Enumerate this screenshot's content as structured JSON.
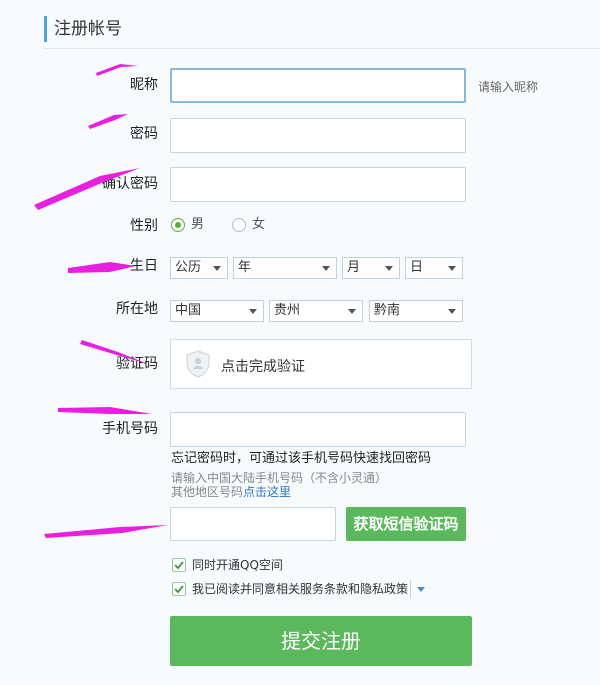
{
  "header": {
    "title": "注册帐号"
  },
  "nickname": {
    "label": "昵称",
    "value": "",
    "hint": "请输入昵称"
  },
  "password": {
    "label": "密码",
    "value": ""
  },
  "confirm_password": {
    "label": "确认密码",
    "value": ""
  },
  "gender": {
    "label": "性别",
    "options": [
      "男",
      "女"
    ],
    "selected": "男"
  },
  "birthday": {
    "label": "生日",
    "calendar": "公历",
    "year": "年",
    "month": "月",
    "day": "日"
  },
  "location": {
    "label": "所在地",
    "country": "中国",
    "province": "贵州",
    "city": "黔南"
  },
  "captcha": {
    "label": "验证码",
    "text": "点击完成验证"
  },
  "phone": {
    "label": "手机号码",
    "value": "",
    "tip": "忘记密码时，可通过该手机号码快速找回密码",
    "note": "请输入中国大陆手机号码（不含小灵通）",
    "other_prefix": "其他地区号码",
    "other_link": "点击这里"
  },
  "sms": {
    "value": "",
    "button": "获取短信验证码"
  },
  "options": {
    "qzone": {
      "label": "同时开通QQ空间",
      "checked": true
    },
    "agree": {
      "label": "我已阅读并同意相关服务条款和隐私政策",
      "checked": true
    }
  },
  "submit": {
    "label": "提交注册"
  },
  "colors": {
    "accent": "#4aa3df",
    "green": "#5cb85c",
    "arrow": "#e81fe0"
  }
}
